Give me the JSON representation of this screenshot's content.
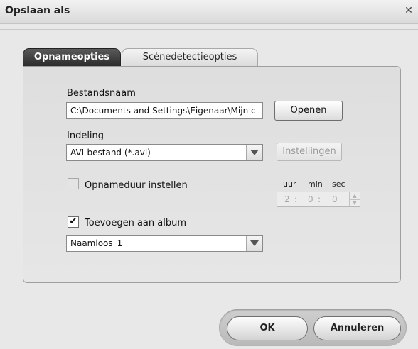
{
  "window": {
    "title": "Opslaan als"
  },
  "tabs": [
    {
      "label": "Opnameopties",
      "active": true
    },
    {
      "label": "Scènedetectieopties",
      "active": false
    }
  ],
  "filename": {
    "label": "Bestandsnaam",
    "value": "C:\\Documents and Settings\\Eigenaar\\Mijn c",
    "open_button": "Openen"
  },
  "format": {
    "label": "Indeling",
    "selected": "AVI-bestand (*.avi)",
    "settings_button": "Instellingen"
  },
  "duration": {
    "checkbox_label": "Opnameduur instellen",
    "checked": false,
    "headers": {
      "hours": "uur",
      "minutes": "min",
      "seconds": "sec"
    },
    "hours": "2",
    "minutes": "0",
    "seconds": "0",
    "sep": ":"
  },
  "album": {
    "checkbox_label": "Toevoegen aan album",
    "checked": true,
    "check_mark": "✔",
    "selected": "Naamloos_1"
  },
  "buttons": {
    "ok": "OK",
    "cancel": "Annuleren"
  }
}
